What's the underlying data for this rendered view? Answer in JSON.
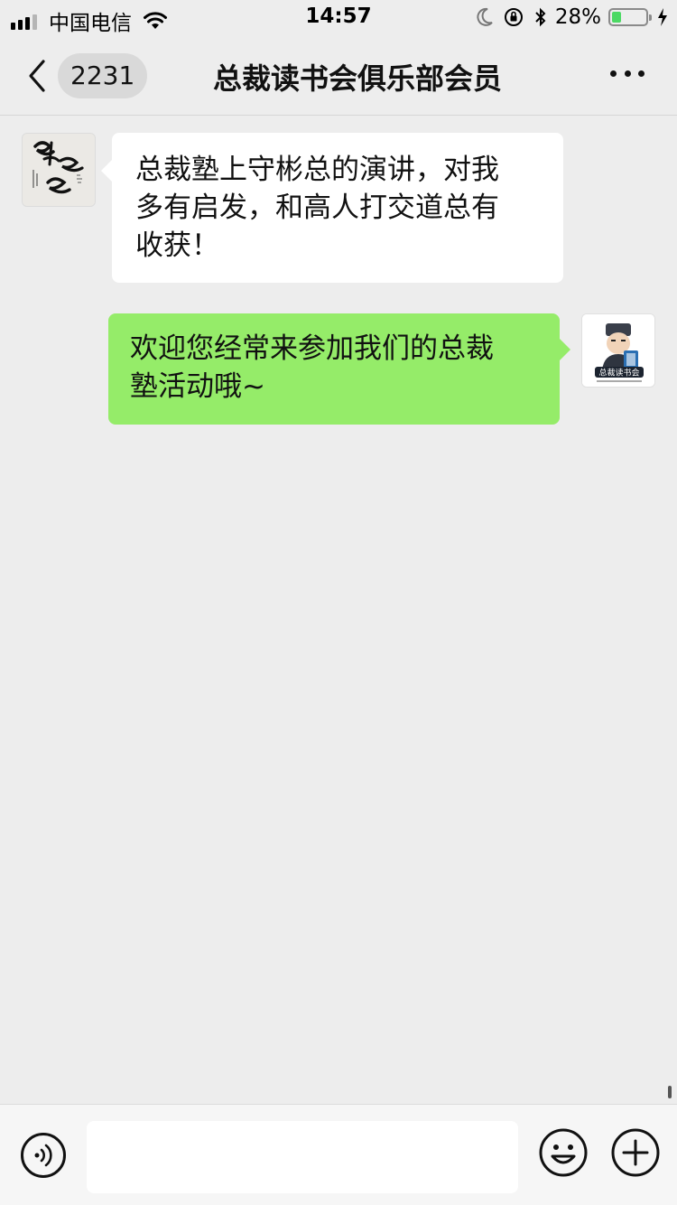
{
  "status_bar": {
    "carrier": "中国电信",
    "time": "14:57",
    "battery_percent": "28%",
    "battery_level": 0.28,
    "icons": [
      "signal-icon",
      "wifi-icon",
      "moon-icon",
      "rotation-lock-icon",
      "bluetooth-icon",
      "battery-icon",
      "charging-icon"
    ]
  },
  "nav": {
    "unread_count": "2231",
    "title": "总裁读书会俱乐部会员",
    "icons": [
      "chevron-left-icon",
      "more-icon"
    ]
  },
  "messages": [
    {
      "direction": "incoming",
      "text_lines": [
        "总裁塾上守彬总的演讲，对我",
        "多有启发，和高人打交道总有",
        "收获！"
      ],
      "bubble_color": "#ffffff",
      "avatar_icon": "calligraphy-avatar-icon"
    },
    {
      "direction": "outgoing",
      "text_lines": [
        "欢迎您经常来参加我们的总裁",
        "塾活动哦~"
      ],
      "bubble_color": "#95ec69",
      "avatar_icon": "book-club-avatar-icon",
      "avatar_badge": "总裁读书会"
    }
  ],
  "input_bar": {
    "value": "",
    "icons": [
      "voice-icon",
      "emoji-icon",
      "plus-icon"
    ]
  },
  "colors": {
    "background": "#ededed",
    "outgoing_bubble": "#95ec69",
    "incoming_bubble": "#ffffff",
    "battery_fill": "#4cd964"
  }
}
